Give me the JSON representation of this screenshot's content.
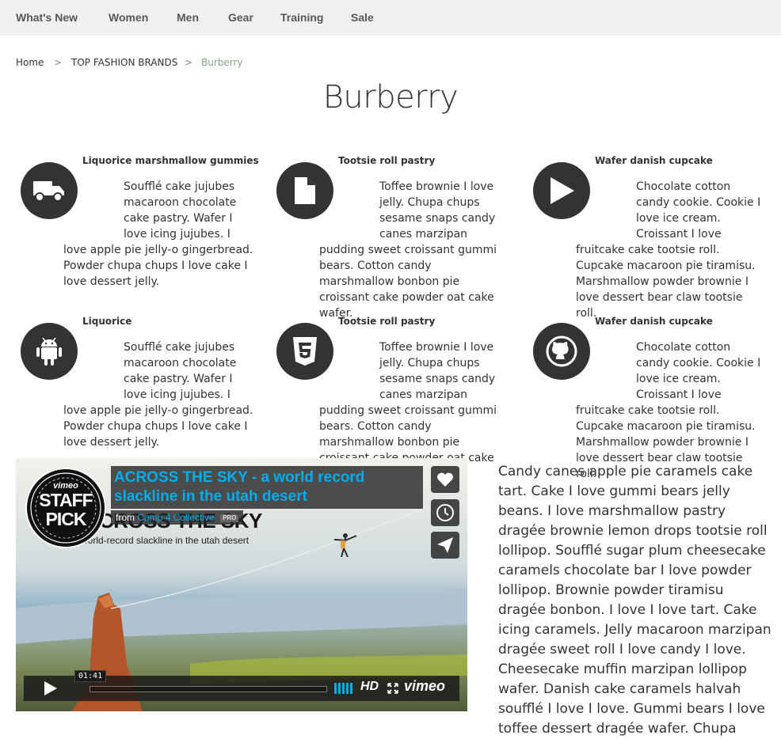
{
  "nav": {
    "items": [
      "What's New",
      "Women",
      "Men",
      "Gear",
      "Training",
      "Sale"
    ]
  },
  "breadcrumb": {
    "home": "Home",
    "category": "TOP FASHION BRANDS",
    "current": "Burberry",
    "separator": ">"
  },
  "page_title": "Burberry",
  "features": [
    {
      "title": "Liquorice marshmallow gummies",
      "icon": "truck-icon",
      "text": "Soufflé cake jujubes macaroon chocolate cake pastry. Wafer I love icing jujubes. I love apple pie jelly-o gingerbread. Powder chupa chups I love cake I love dessert jelly."
    },
    {
      "title": "Tootsie roll pastry",
      "icon": "file-icon",
      "text": "Toffee brownie I love jelly. Chupa chups sesame snaps candy canes marzipan pudding sweet croissant gummi bears. Cotton candy marshmallow bonbon pie croissant cake powder oat cake wafer."
    },
    {
      "title": "Wafer danish cupcake",
      "icon": "play-icon",
      "text": "Chocolate cotton candy cookie. Cookie I love ice cream. Croissant I love fruitcake cake tootsie roll. Cupcake macaroon pie tiramisu. Marshmallow powder brownie I love dessert bear claw tootsie roll."
    },
    {
      "title": "Liquorice",
      "icon": "android-icon",
      "text": "Soufflé cake jujubes macaroon chocolate cake pastry. Wafer I love icing jujubes. I love apple pie jelly-o gingerbread. Powder chupa chups I love cake I love dessert jelly."
    },
    {
      "title": "Tootsie roll pastry",
      "icon": "html5-icon",
      "text": "Toffee brownie I love jelly. Chupa chups sesame snaps candy canes marzipan pudding sweet croissant gummi bears. Cotton candy marshmallow bonbon pie croissant cake powder oat cake wafer."
    },
    {
      "title": "Wafer danish cupcake",
      "icon": "github-icon",
      "text": "Chocolate cotton candy cookie. Cookie I love ice cream. Croissant I love fruitcake cake tootsie roll. Cupcake macaroon pie tiramisu. Marshmallow powder brownie I love dessert bear claw tootsie roll."
    }
  ],
  "video": {
    "title": "ACROSS THE SKY - a world record slackline in the utah desert",
    "from_label": "from",
    "author": "Camp 4 Collective",
    "badge": "PRO",
    "overlay_big": "CROSS THE SKY",
    "overlay_sub": "a world-record slackline in the utah desert",
    "staff_pick_brand": "vimeo",
    "staff_pick_line1": "STAFF",
    "staff_pick_line2": "PICK",
    "time": "01:41",
    "hd": "HD",
    "logo": "vimeo"
  },
  "article_text": "Candy canes apple pie caramels cake tart. Cake I love gummi bears jelly beans. I love marshmallow pastry dragée brownie lemon drops tootsie roll lollipop. Soufflé sugar plum cheesecake caramels chocolate bar I love powder lollipop. Brownie powder tiramisu dragée bonbon. I love I love tart. Cake icing caramels. Jelly macaroon marzipan dragée sweet roll I love candy I love. Cheesecake muffin marzipan lollipop wafer. Danish cake caramels halvah soufflé I love I love. Gummi bears I love toffee dessert dragée wafer. Chupa"
}
